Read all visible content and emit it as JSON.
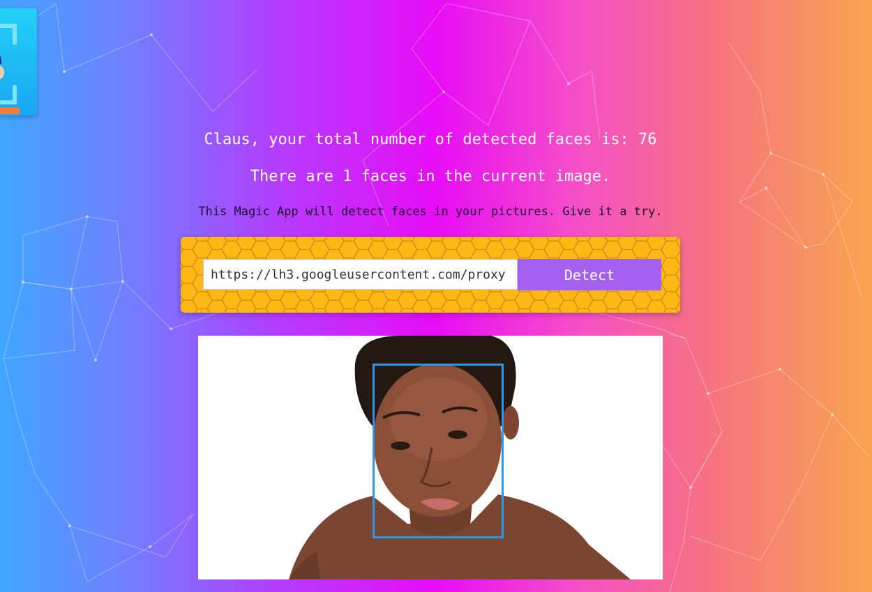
{
  "logo": {
    "icon": "face-scan-icon"
  },
  "status": {
    "total_line": "Claus, your total number of detected faces is: 76",
    "current_line": "There are 1 faces in the current image."
  },
  "intro": {
    "text": "This Magic App will detect faces in your pictures. Give it a try."
  },
  "form": {
    "url_value": "https://lh3.googleusercontent.com/proxy",
    "detect_label": "Detect"
  },
  "result": {
    "faces_detected": 1,
    "box_color": "#2c98e8"
  },
  "colors": {
    "panel": "#fdb813",
    "button": "#a460ee",
    "gradient_left": "#3fa6ff",
    "gradient_mid": "#e80cf6",
    "gradient_right": "#f7a54e"
  }
}
